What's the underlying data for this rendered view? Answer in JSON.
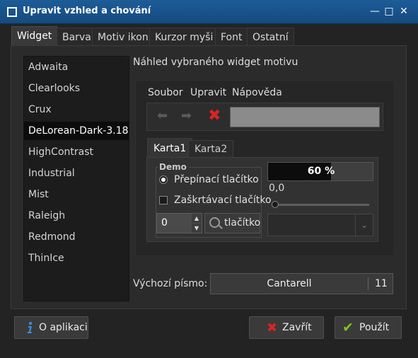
{
  "window": {
    "title": "Upravit vzhled a chování"
  },
  "tabs": [
    "Widget",
    "Barva",
    "Motiv ikon",
    "Kurzor myši",
    "Font",
    "Ostatní"
  ],
  "themes": {
    "items": [
      "Adwaita",
      "Clearlooks",
      "Crux",
      "DeLorean-Dark-3.18",
      "HighContrast",
      "Industrial",
      "Mist",
      "Raleigh",
      "Redmond",
      "ThinIce"
    ],
    "selected": "DeLorean-Dark-3.18"
  },
  "preview": {
    "label": "Náhled vybraného widget motivu",
    "menu": [
      "Soubor",
      "Upravit",
      "Nápověda"
    ],
    "inner_tabs": [
      "Karta1",
      "Karta2"
    ],
    "frame_label": "Demo",
    "radio_label": "Přepínací tlačítko",
    "check_label": "Zaškrtávací tlačítko",
    "spin_value": "0",
    "button_label": "tlačítko",
    "progress": {
      "value": 0.6,
      "text": "60 %"
    },
    "scale_value": "0,0"
  },
  "font": {
    "label": "Výchozí písmo:",
    "name": "Cantarell",
    "size": "11"
  },
  "buttons": {
    "about": "O aplikaci",
    "close": "Zavřít",
    "apply": "Použít"
  },
  "colors": {
    "titlebar": "#1d5c97",
    "close_icon": "#d82424",
    "apply_icon": "#7cc41e",
    "info_icon": "#3a8ddc"
  },
  "icons": [
    "window-icon",
    "minimize-icon",
    "maximize-icon",
    "close-icon",
    "back-icon",
    "forward-icon",
    "stop-icon",
    "search-icon",
    "info-icon",
    "close-red-icon",
    "apply-check-icon",
    "combo-arrow-icon"
  ]
}
